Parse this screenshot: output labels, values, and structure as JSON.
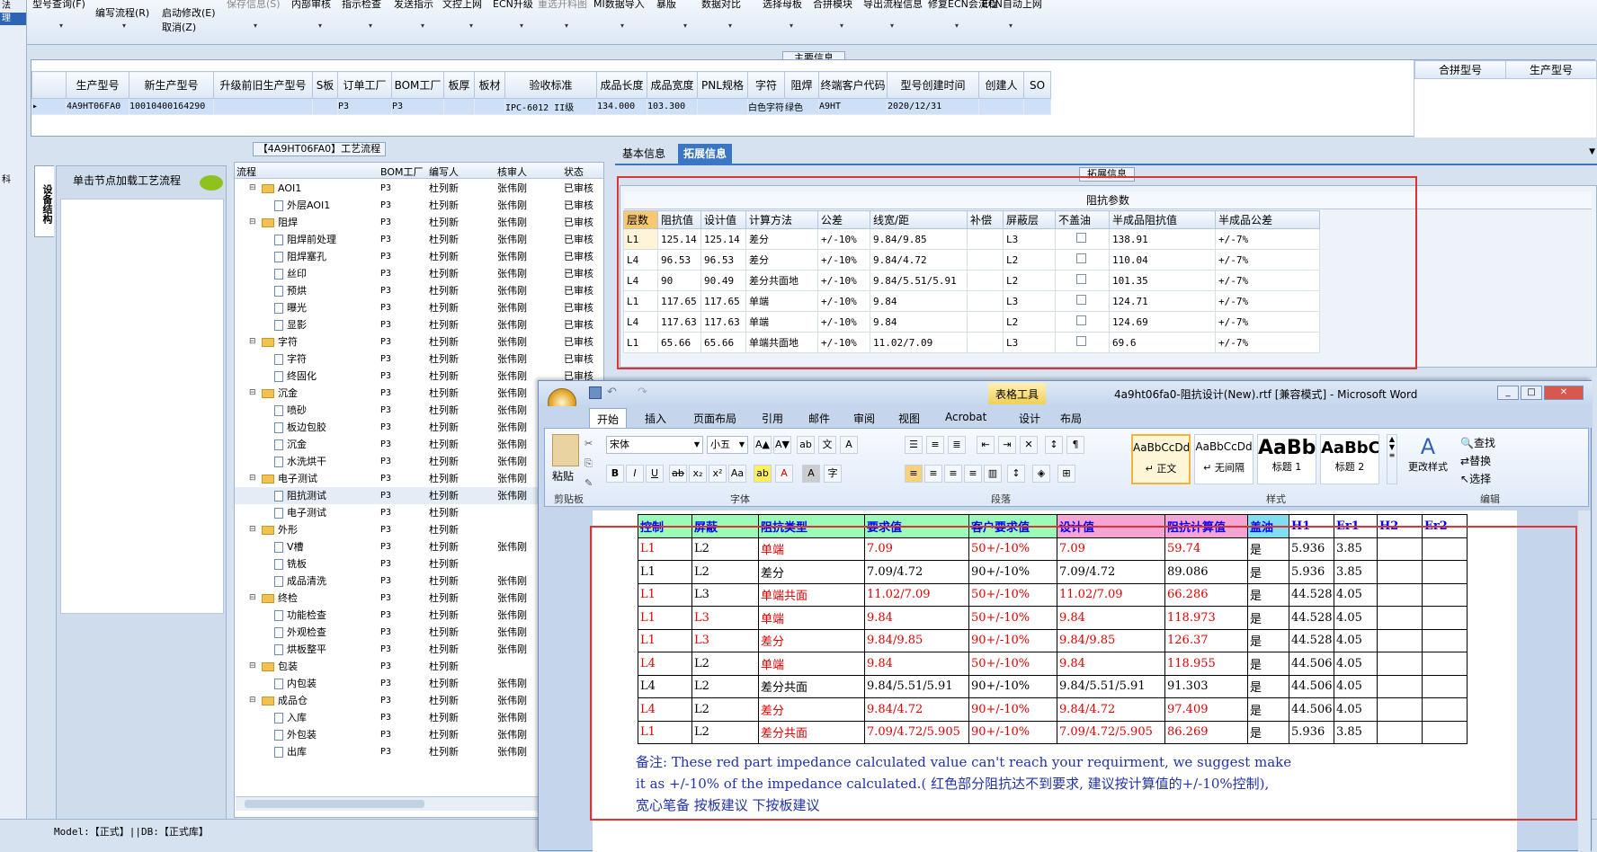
{
  "left_strip": [
    "法",
    "理"
  ],
  "left_strip_extra": "科",
  "left_strip_footer": "刚",
  "ribbon": {
    "buttons": [
      {
        "label": "型号查询(F)",
        "dis": false
      },
      {
        "label": "编写流程(R)",
        "dis": false
      },
      {
        "label": "启动修改(E)",
        "dis": false
      },
      {
        "label": "取消(Z)",
        "dis": false
      },
      {
        "label": "保存信息(S)",
        "dis": true
      },
      {
        "label": "内部审核",
        "dis": false
      },
      {
        "label": "指示检查",
        "dis": false
      },
      {
        "label": "发送指示",
        "dis": false
      },
      {
        "label": "文控上网",
        "dis": false
      },
      {
        "label": "ECN升级",
        "dis": false
      },
      {
        "label": "重选开料图",
        "dis": true
      },
      {
        "label": "MI数据导入",
        "dis": false
      },
      {
        "label": "暴版",
        "dis": false
      },
      {
        "label": "数据对比",
        "dis": false
      },
      {
        "label": "选择母板",
        "dis": false
      },
      {
        "label": "合拼模块",
        "dis": false
      },
      {
        "label": "导出流程信息",
        "dis": false
      },
      {
        "label": "修复ECN会流程",
        "dis": false
      },
      {
        "label": "ECN自动上网",
        "dis": false
      }
    ]
  },
  "main_info": {
    "title": "主要信息",
    "headers": [
      "生产型号",
      "新生产型号",
      "升级前旧生产型号",
      "S板",
      "订单工厂",
      "BOM工厂",
      "板厚",
      "板材",
      "验收标准",
      "成品长度",
      "成品宽度",
      "PNL规格",
      "字符",
      "阻焊",
      "终端客户代码",
      "型号创建时间",
      "创建人",
      "SO"
    ],
    "row": [
      "4A9HT06FA0",
      "10010400164290",
      "",
      "",
      "P3",
      "P3",
      "",
      "",
      "IPC-6012 II级",
      "134.000",
      "103.300",
      "",
      "白色字符",
      "绿色",
      "A9HT",
      "2020/12/31",
      "",
      ""
    ],
    "side_headers": [
      "合拼型号",
      "生产型号"
    ]
  },
  "process": {
    "title": "【4A9HT06FA0】工艺流程",
    "side_tab": "设备结构",
    "node_header": "单击节点加载工艺流程",
    "columns": [
      "流程",
      "BOM工厂",
      "编写人",
      "核审人",
      "状态"
    ],
    "rows": [
      {
        "name": "AOI1",
        "lv": 1,
        "bom": "P3",
        "w": "杜列新",
        "r": "张伟刚",
        "s": "已审核"
      },
      {
        "name": "外层AOI1",
        "lv": 2,
        "bom": "P3",
        "w": "杜列新",
        "r": "张伟刚",
        "s": "已审核"
      },
      {
        "name": "阻焊",
        "lv": 1,
        "bom": "P3",
        "w": "杜列新",
        "r": "张伟刚",
        "s": "已审核"
      },
      {
        "name": "阻焊前处理",
        "lv": 2,
        "bom": "P3",
        "w": "杜列新",
        "r": "张伟刚",
        "s": "已审核"
      },
      {
        "name": "阻焊塞孔",
        "lv": 2,
        "bom": "P3",
        "w": "杜列新",
        "r": "张伟刚",
        "s": "已审核"
      },
      {
        "name": "丝印",
        "lv": 2,
        "bom": "P3",
        "w": "杜列新",
        "r": "张伟刚",
        "s": "已审核"
      },
      {
        "name": "预烘",
        "lv": 2,
        "bom": "P3",
        "w": "杜列新",
        "r": "张伟刚",
        "s": "已审核"
      },
      {
        "name": "曝光",
        "lv": 2,
        "bom": "P3",
        "w": "杜列新",
        "r": "张伟刚",
        "s": "已审核"
      },
      {
        "name": "显影",
        "lv": 2,
        "bom": "P3",
        "w": "杜列新",
        "r": "张伟刚",
        "s": "已审核"
      },
      {
        "name": "字符",
        "lv": 1,
        "bom": "P3",
        "w": "杜列新",
        "r": "张伟刚",
        "s": "已审核"
      },
      {
        "name": "字符",
        "lv": 2,
        "bom": "P3",
        "w": "杜列新",
        "r": "张伟刚",
        "s": "已审核"
      },
      {
        "name": "终固化",
        "lv": 2,
        "bom": "P3",
        "w": "杜列新",
        "r": "张伟刚",
        "s": "已审核"
      },
      {
        "name": "沉金",
        "lv": 1,
        "bom": "P3",
        "w": "杜列新",
        "r": "张伟刚",
        "s": "已审核"
      },
      {
        "name": "喷砂",
        "lv": 2,
        "bom": "P3",
        "w": "杜列新",
        "r": "张伟刚",
        "s": "已审核"
      },
      {
        "name": "板边包胶",
        "lv": 2,
        "bom": "P3",
        "w": "杜列新",
        "r": "张伟刚",
        "s": "已审核"
      },
      {
        "name": "沉金",
        "lv": 2,
        "bom": "P3",
        "w": "杜列新",
        "r": "张伟刚",
        "s": "已审核"
      },
      {
        "name": "水洗烘干",
        "lv": 2,
        "bom": "P3",
        "w": "杜列新",
        "r": "张伟刚",
        "s": "已审核"
      },
      {
        "name": "电子测试",
        "lv": 1,
        "bom": "P3",
        "w": "杜列新",
        "r": "张伟刚",
        "s": ""
      },
      {
        "name": "阻抗测试",
        "lv": 2,
        "bom": "P3",
        "w": "杜列新",
        "r": "张伟刚",
        "s": "",
        "hl": true
      },
      {
        "name": "电子测试",
        "lv": 2,
        "bom": "P3",
        "w": "杜列新",
        "r": "",
        "s": ""
      },
      {
        "name": "外形",
        "lv": 1,
        "bom": "P3",
        "w": "杜列新",
        "r": "",
        "s": ""
      },
      {
        "name": "V槽",
        "lv": 2,
        "bom": "P3",
        "w": "杜列新",
        "r": "张伟刚",
        "s": ""
      },
      {
        "name": "铣板",
        "lv": 2,
        "bom": "P3",
        "w": "杜列新",
        "r": "",
        "s": ""
      },
      {
        "name": "成品清洗",
        "lv": 2,
        "bom": "P3",
        "w": "杜列新",
        "r": "张伟刚",
        "s": ""
      },
      {
        "name": "终检",
        "lv": 1,
        "bom": "P3",
        "w": "杜列新",
        "r": "张伟刚",
        "s": ""
      },
      {
        "name": "功能检查",
        "lv": 2,
        "bom": "P3",
        "w": "杜列新",
        "r": "张伟刚",
        "s": ""
      },
      {
        "name": "外观检查",
        "lv": 2,
        "bom": "P3",
        "w": "杜列新",
        "r": "张伟刚",
        "s": ""
      },
      {
        "name": "烘板整平",
        "lv": 2,
        "bom": "P3",
        "w": "杜列新",
        "r": "张伟刚",
        "s": ""
      },
      {
        "name": "包装",
        "lv": 1,
        "bom": "P3",
        "w": "杜列新",
        "r": "",
        "s": ""
      },
      {
        "name": "内包装",
        "lv": 2,
        "bom": "P3",
        "w": "杜列新",
        "r": "张伟刚",
        "s": ""
      },
      {
        "name": "成品仓",
        "lv": 1,
        "bom": "P3",
        "w": "杜列新",
        "r": "张伟刚",
        "s": ""
      },
      {
        "name": "入库",
        "lv": 2,
        "bom": "P3",
        "w": "杜列新",
        "r": "张伟刚",
        "s": ""
      },
      {
        "name": "外包装",
        "lv": 2,
        "bom": "P3",
        "w": "杜列新",
        "r": "张伟刚",
        "s": ""
      },
      {
        "name": "出库",
        "lv": 2,
        "bom": "P3",
        "w": "杜列新",
        "r": "张伟刚",
        "s": ""
      }
    ]
  },
  "tabs": [
    "基本信息",
    "拓展信息"
  ],
  "ext": {
    "label": "拓展信息",
    "table_title": "阻抗参数",
    "headers": [
      "层数",
      "阻抗值",
      "设计值",
      "计算方法",
      "公差",
      "线宽/距",
      "补偿",
      "屏蔽层",
      "不盖油",
      "半成品阻抗值",
      "半成品公差"
    ],
    "rows": [
      [
        "L1",
        "125.14",
        "125.14",
        "差分",
        "+/-10%",
        "9.84/9.85",
        "",
        "L3",
        "",
        "138.91",
        "+/-7%"
      ],
      [
        "L4",
        "96.53",
        "96.53",
        "差分",
        "+/-10%",
        "9.84/4.72",
        "",
        "L2",
        "",
        "110.04",
        "+/-7%"
      ],
      [
        "L4",
        "90",
        "90.49",
        "差分共面地",
        "+/-10%",
        "9.84/5.51/5.91",
        "",
        "L2",
        "",
        "101.35",
        "+/-7%"
      ],
      [
        "L1",
        "117.65",
        "117.65",
        "单端",
        "+/-10%",
        "9.84",
        "",
        "L3",
        "",
        "124.71",
        "+/-7%"
      ],
      [
        "L4",
        "117.63",
        "117.63",
        "单端",
        "+/-10%",
        "9.84",
        "",
        "L2",
        "",
        "124.69",
        "+/-7%"
      ],
      [
        "L1",
        "65.66",
        "65.66",
        "单端共面地",
        "+/-10%",
        "11.02/7.09",
        "",
        "L3",
        "",
        "69.6",
        "+/-7%"
      ]
    ]
  },
  "word": {
    "title": "4a9ht06fa0-阻抗设计(New).rtf [兼容模式] - Microsoft Word",
    "context_tab": "表格工具",
    "tabs": [
      "开始",
      "插入",
      "页面布局",
      "引用",
      "邮件",
      "审阅",
      "视图",
      "Acrobat",
      "设计",
      "布局"
    ],
    "font": "宋体",
    "size": "小五",
    "paste": "粘贴",
    "groups": [
      "剪贴板",
      "字体",
      "段落",
      "样式",
      "编辑"
    ],
    "styles": [
      {
        "sample": "AaBbCcDd",
        "name": "↵ 正文"
      },
      {
        "sample": "AaBbCcDd",
        "name": "↵ 无间隔"
      },
      {
        "sample": "AaBb",
        "name": "标题 1"
      },
      {
        "sample": "AaBbC",
        "name": "标题 2"
      }
    ],
    "change_style": "更改样式",
    "edit": [
      "查找",
      "替换",
      "选择"
    ],
    "table_headers": [
      "控制",
      "屏蔽",
      "阻抗类型",
      "要求值",
      "客户要求值",
      "设计值",
      "阻抗计算值",
      "盖油",
      "H1",
      "Er1",
      "H2",
      "Er2"
    ],
    "table_rows": [
      {
        "c": [
          "L1",
          "L2",
          "单端",
          "7.09",
          "50+/-10%",
          "7.09",
          "59.74",
          "是",
          "5.936",
          "3.85",
          "",
          ""
        ],
        "red": true
      },
      {
        "c": [
          "L1",
          "L2",
          "差分",
          "7.09/4.72",
          "90+/-10%",
          "7.09/4.72",
          "89.086",
          "是",
          "5.936",
          "3.85",
          "",
          ""
        ],
        "red": false
      },
      {
        "c": [
          "L1",
          "L3",
          "单端共面",
          "11.02/7.09",
          "50+/-10%",
          "11.02/7.09",
          "66.286",
          "是",
          "44.528",
          "4.05",
          "",
          ""
        ],
        "red": true
      },
      {
        "c": [
          "L1",
          "L3",
          "单端",
          "9.84",
          "50+/-10%",
          "9.84",
          "118.973",
          "是",
          "44.528",
          "4.05",
          "",
          ""
        ],
        "red": true
      },
      {
        "c": [
          "L1",
          "L3",
          "差分",
          "9.84/9.85",
          "90+/-10%",
          "9.84/9.85",
          "126.37",
          "是",
          "44.528",
          "4.05",
          "",
          ""
        ],
        "red": true
      },
      {
        "c": [
          "L4",
          "L2",
          "单端",
          "9.84",
          "50+/-10%",
          "9.84",
          "118.955",
          "是",
          "44.506",
          "4.05",
          "",
          ""
        ],
        "red": true
      },
      {
        "c": [
          "L4",
          "L2",
          "差分共面",
          "9.84/5.51/5.91",
          "90+/-10%",
          "9.84/5.51/5.91",
          "91.303",
          "是",
          "44.506",
          "4.05",
          "",
          ""
        ],
        "red": false
      },
      {
        "c": [
          "L4",
          "L2",
          "差分",
          "9.84/4.72",
          "90+/-10%",
          "9.84/4.72",
          "97.409",
          "是",
          "44.506",
          "4.05",
          "",
          ""
        ],
        "red": true
      },
      {
        "c": [
          "L1",
          "L2",
          "差分共面",
          "7.09/4.72/5.905",
          "90+/-10%",
          "7.09/4.72/5.905",
          "86.269",
          "是",
          "5.936",
          "3.85",
          "",
          ""
        ],
        "red": true
      }
    ],
    "note_line1": "备注: These red part impedance calculated  value can't reach your requirment, we suggest make",
    "note_line2": "it as +/-10% of the impedance calculated.( 红色部分阻抗达不到要求, 建议按计算值的+/-10%控制),",
    "note_line3": "宽心笔备                    按板建议                    下按板建议"
  },
  "status": "Model:【正式】||DB:【正式库】",
  "colors": {
    "accent": "#3a76c4",
    "highlight_red": "#d33",
    "header_green": "#9bfcb8",
    "header_pink": "#f6a4d4",
    "header_cyan": "#7fdff0"
  }
}
